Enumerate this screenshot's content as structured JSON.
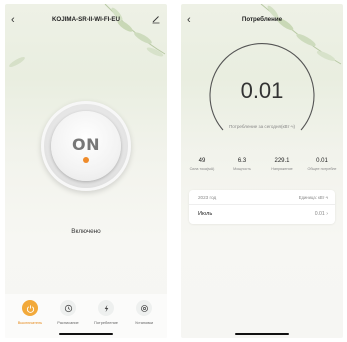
{
  "left": {
    "title": "KOJIMA-SR-II-WI-FI-EU",
    "power_label": "ON",
    "status_text": "Включено",
    "tabs": [
      {
        "label": "Выключатель",
        "icon": "power-icon"
      },
      {
        "label": "Расписание",
        "icon": "clock-icon"
      },
      {
        "label": "Потребление",
        "icon": "lightning-icon"
      },
      {
        "label": "Установки",
        "icon": "gear-icon"
      }
    ],
    "accent": "#f2a93a"
  },
  "right": {
    "title": "Потребление",
    "today_value": "0.01",
    "today_caption": "Потребление за сегодня(кВт·ч)",
    "stats": [
      {
        "value": "49",
        "label": "Сила тока(мА)"
      },
      {
        "value": "6.3",
        "label": "Мощность"
      },
      {
        "value": "229.1",
        "label": "Напряжение"
      },
      {
        "value": "0.01",
        "label": "Общее потребле"
      }
    ],
    "year": "2023 год",
    "unit": "Единица: кВт·ч",
    "month": "Июль",
    "month_value": "0.01"
  }
}
